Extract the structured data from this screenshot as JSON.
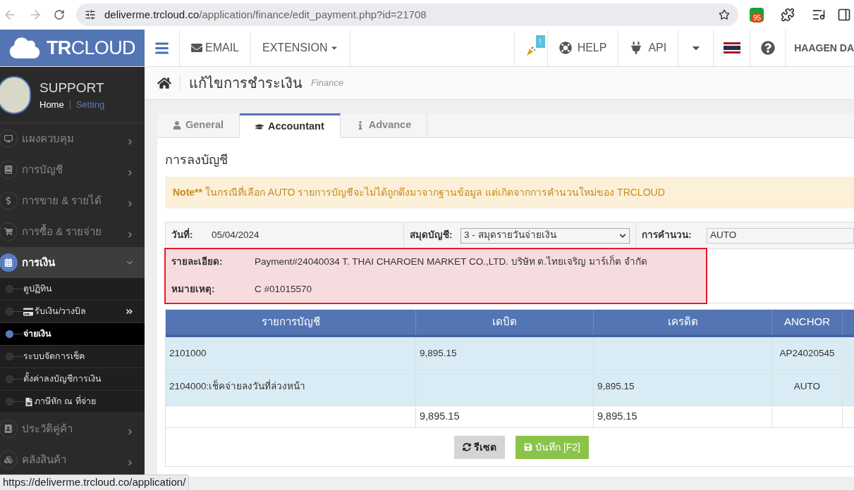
{
  "browser": {
    "url_host": "deliverme.trcloud.co",
    "url_path": "/application/finance/edit_payment.php?id=21708",
    "extension_badge": "95"
  },
  "header": {
    "logo": "TRCLOUD",
    "nav": [
      "EMAIL",
      "EXTENSION"
    ],
    "notification_badge": "!",
    "help": "HELP",
    "api": "API",
    "user": "HAAGEN DA"
  },
  "sidebar": {
    "user_name": "SUPPORT",
    "links": [
      "Home",
      "Setting"
    ],
    "menu": [
      {
        "label": "แผงควบคุม",
        "expanded": false
      },
      {
        "label": "การบัญชี",
        "expanded": false
      },
      {
        "label": "การขาย & รายได้",
        "expanded": false
      },
      {
        "label": "การซื้อ & รายจ่าย",
        "expanded": false
      },
      {
        "label": "การเงิน",
        "expanded": true,
        "children": [
          {
            "label": "ดูปฏิทิน",
            "selected": false
          },
          {
            "label": "รับเงิน/วางบิล",
            "selected": false
          },
          {
            "label": "จ่ายเงิน",
            "selected": true
          },
          {
            "label": "ระบบจัดการเช็ค",
            "selected": false
          },
          {
            "label": "ตั้งค่าลงบัญชีการเงิน",
            "selected": false
          },
          {
            "label": "ภาษีหัก ณ ที่จ่าย",
            "selected": false
          }
        ]
      },
      {
        "label": "ประวัติคู่ค้า",
        "expanded": false
      },
      {
        "label": "คลังสินค้า",
        "expanded": false
      }
    ]
  },
  "page": {
    "title": "แก้ไขการชำระเงิน",
    "subtitle": "Finance",
    "tabs": [
      {
        "label": "General",
        "selected": false
      },
      {
        "label": "Accountant",
        "selected": true
      },
      {
        "label": "Advance",
        "selected": false
      }
    ],
    "section_title": "การลงบัญชี",
    "note": {
      "label": "Note**",
      "text": "ในกรณีที่เลือก AUTO รายการบัญชีจะไม่ได้ถูกดึงมาจากฐานข้อมูล แต่เกิดจากการคำนวนใหม่ของ TRCLOUD"
    },
    "form": {
      "date_label": "วันที่:",
      "date_value": "05/04/2024",
      "book_label": "สมุดบัญชี:",
      "book_value": "3 - สมุดรายวันจ่ายเงิน",
      "calc_label": "การคำนวน:",
      "calc_value": "AUTO",
      "detail_label": "รายละเอียด:",
      "detail_value": "Payment#24040034 T. THAI CHAROEN MARKET CO.,LTD. บริษัท ต.ไทยเจริญ มาร์เก็ต จำกัด",
      "remark_label": "หมายเหตุ:",
      "remark_value": "C #01015570",
      "highlighted": true
    },
    "table": {
      "columns": [
        "รายการบัญชี",
        "เดบิต",
        "เครดิต",
        "ANCHOR"
      ],
      "rows": [
        [
          "2101000",
          "9,895.15",
          null,
          "AP24020545"
        ],
        [
          "2104000:เช็คจ่ายลงวันที่ล่วงหน้า",
          null,
          "9,895.15",
          "AUTO"
        ]
      ],
      "totals": {
        "debit": "9,895.15",
        "credit": "9,895.15"
      }
    },
    "buttons": [
      "รีเซต",
      "บันทึก [F2]"
    ]
  },
  "status_url": "https://deliverme.trcloud.co/application/"
}
